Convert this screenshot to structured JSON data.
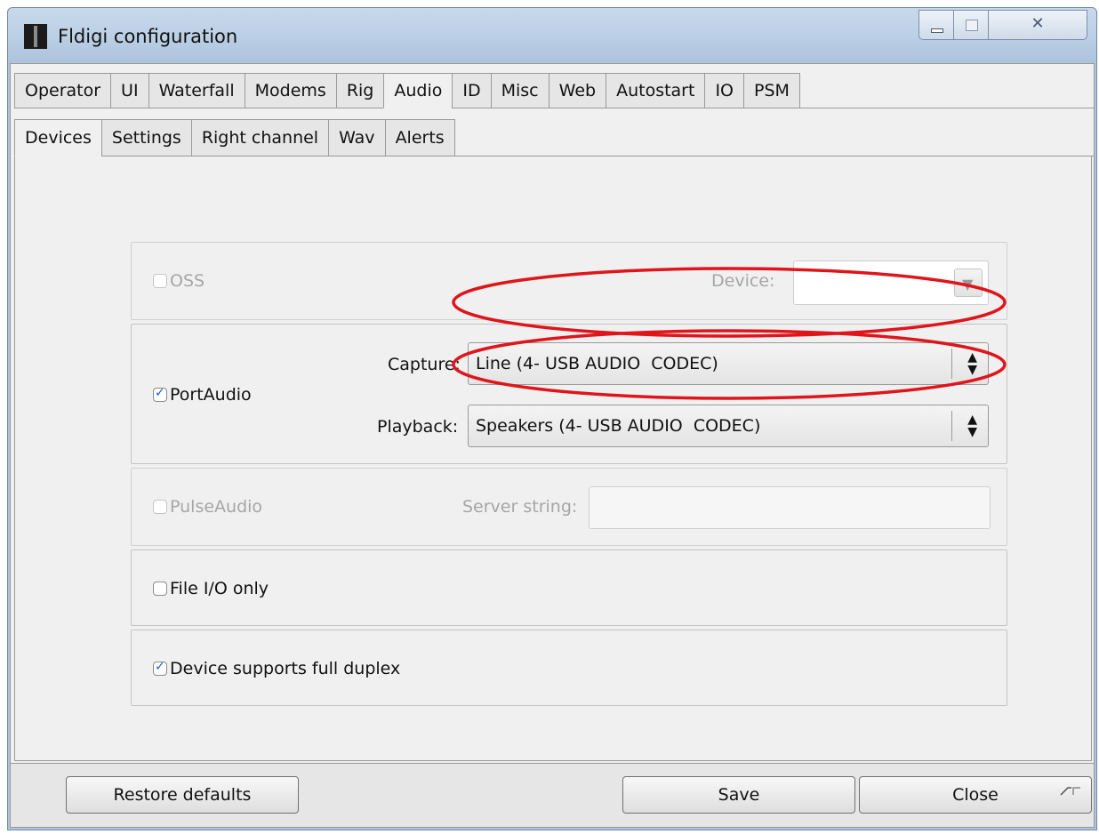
{
  "window": {
    "title": "Fldigi configuration"
  },
  "tabs_main": [
    "Operator",
    "UI",
    "Waterfall",
    "Modems",
    "Rig",
    "Audio",
    "ID",
    "Misc",
    "Web",
    "Autostart",
    "IO",
    "PSM"
  ],
  "tabs_main_active": "Audio",
  "tabs_sub": [
    "Devices",
    "Settings",
    "Right channel",
    "Wav",
    "Alerts"
  ],
  "tabs_sub_active": "Devices",
  "oss": {
    "label": "OSS",
    "checked": false,
    "enabled": false,
    "device_label": "Device:"
  },
  "portaudio": {
    "label": "PortAudio",
    "checked": true,
    "capture_label": "Capture:",
    "capture_value": "Line (4- USB AUDIO  CODEC)",
    "playback_label": "Playback:",
    "playback_value": "Speakers (4- USB AUDIO  CODEC)"
  },
  "pulseaudio": {
    "label": "PulseAudio",
    "checked": false,
    "enabled": false,
    "server_label": "Server string:",
    "server_value": ""
  },
  "file_io": {
    "label": "File I/O only",
    "checked": false
  },
  "full_duplex": {
    "label": "Device supports full duplex",
    "checked": true
  },
  "buttons": {
    "restore": "Restore defaults",
    "save": "Save",
    "close": "Close"
  },
  "icons": [
    "app-icon",
    "minimize-icon",
    "maximize-icon",
    "close-icon",
    "checkbox-icon",
    "dropdown-arrow-icon",
    "spin-arrows-icon",
    "resize-grip-icon"
  ],
  "annotation_color": "#e0151b"
}
